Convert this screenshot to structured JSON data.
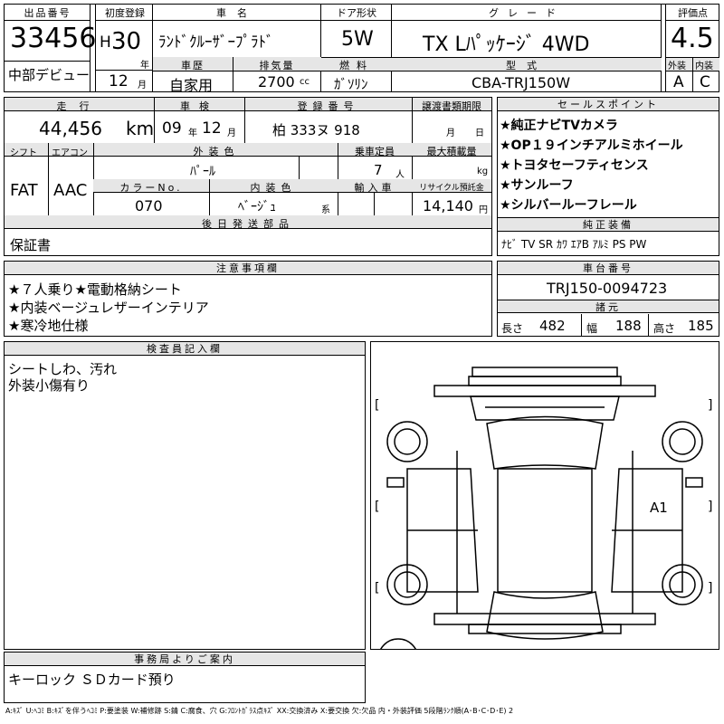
{
  "top": {
    "lot_no_label": "出品番号",
    "lot_no": "33456",
    "origin": "中部デビュー",
    "first_reg_label": "初度登録",
    "era": "H",
    "year": "30",
    "year_unit": "年",
    "month": "12",
    "month_unit": "月",
    "car_name_label": "車名",
    "car_name": "ﾗﾝﾄﾞｸﾙｰｻﾞｰﾌﾟﾗﾄﾞ",
    "door_label": "ドア形状",
    "door": "5W",
    "grade_label": "グレード",
    "grade": "TX Lﾊﾟｯｹｰｼﾞ 4WD",
    "score_label": "評価点",
    "score": "4.5",
    "history_label": "車歴",
    "history": "自家用",
    "displacement_label": "排気量",
    "displacement": "2700",
    "displacement_unit": "cc",
    "fuel_label": "燃料",
    "fuel": "ｶﾞｿﾘﾝ",
    "model_label": "型式",
    "model": "CBA-TRJ150W",
    "ext_grade_label": "外装",
    "int_grade_label": "内装",
    "ext_grade": "A",
    "int_grade": "C"
  },
  "row2": {
    "mileage_label": "走行",
    "mileage": "44,456",
    "mileage_unit": "km",
    "inspection_label": "車検",
    "inspection_year": "09",
    "inspection_year_unit": "年",
    "inspection_month": "12",
    "inspection_month_unit": "月",
    "plate_label": "登録番号",
    "plate": "柏 333ヌ 918",
    "transfer_label": "譲渡書類期限",
    "transfer_month_unit": "月",
    "transfer_day_unit": "日",
    "shift_label": "シフト",
    "shift": "FAT",
    "ac_label": "エアコン",
    "ac": "AAC",
    "exterior_color_label": "外装色",
    "exterior_color": "ﾊﾟｰﾙ",
    "capacity_label": "乗車定員",
    "capacity": "7",
    "capacity_unit": "人",
    "max_load_label": "最大積載量",
    "max_load_unit": "kg",
    "color_no_label": "カラーNo.",
    "color_no": "070",
    "interior_color_label": "内装色",
    "interior_color": "ﾍﾞｰｼﾞｭ",
    "interior_color_unit": "系",
    "import_label": "輸入車",
    "recycle_label": "リサイクル預託金",
    "recycle": "14,140",
    "recycle_unit": "円",
    "later_docs_label": "後日発送部品",
    "later_docs": "保証書"
  },
  "sales": {
    "label": "セールスポイント",
    "points": [
      "★純正ナビTVカメラ",
      "★OP１９インチアルミホイール",
      "★トヨタセーフティセンス",
      "★サンルーフ",
      "★シルバールーフレール"
    ],
    "equipment_label": "純正装備",
    "equipment": "ﾅﾋﾞ TV SR ｶﾜ ｴｱB ｱﾙﾐ PS PW"
  },
  "notes": {
    "label": "注意事項欄",
    "lines": [
      "★７人乗り★電動格納シート",
      "★内装ベージュレザーインテリア",
      "★寒冷地仕様"
    ]
  },
  "chassis": {
    "label": "車台番号",
    "value": "TRJ150-0094723",
    "dims_label": "諸元",
    "length_label": "長さ",
    "length": "482",
    "width_label": "幅",
    "width": "188",
    "height_label": "高さ",
    "height": "185"
  },
  "inspector": {
    "label": "検査員記入欄",
    "lines": [
      "シートしわ、汚れ",
      "外装小傷有り"
    ]
  },
  "diagram": {
    "marks": [
      "A1"
    ],
    "bracket_open": "[",
    "bracket_close": "]"
  },
  "office": {
    "label": "事務局よりご案内",
    "text": "キーロック ＳＤカード預り"
  },
  "legend": "A:ｷｽﾞ U:ﾍｺﾐ B:ｷｽﾞを伴うﾍｺﾐ P:要塗装 W:補修跡 S:錆 C:腐食、穴 G:ﾌﾛﾝﾄｶﾞﾗｽ点ｷｽﾞ XX:交換済み X:要交換 欠:欠品 内・外装評価 5段階ﾗﾝｸ順(A･B･C･D･E) 2"
}
